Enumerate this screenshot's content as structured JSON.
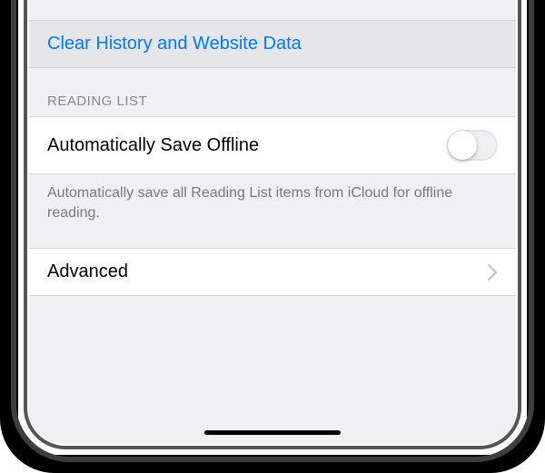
{
  "clearRow": {
    "label": "Clear History and Website Data"
  },
  "readingList": {
    "header": "Reading List",
    "toggleLabel": "Automatically Save Offline",
    "toggleOn": false,
    "footer": "Automatically save all Reading List items from iCloud for offline reading."
  },
  "advancedRow": {
    "label": "Advanced"
  }
}
